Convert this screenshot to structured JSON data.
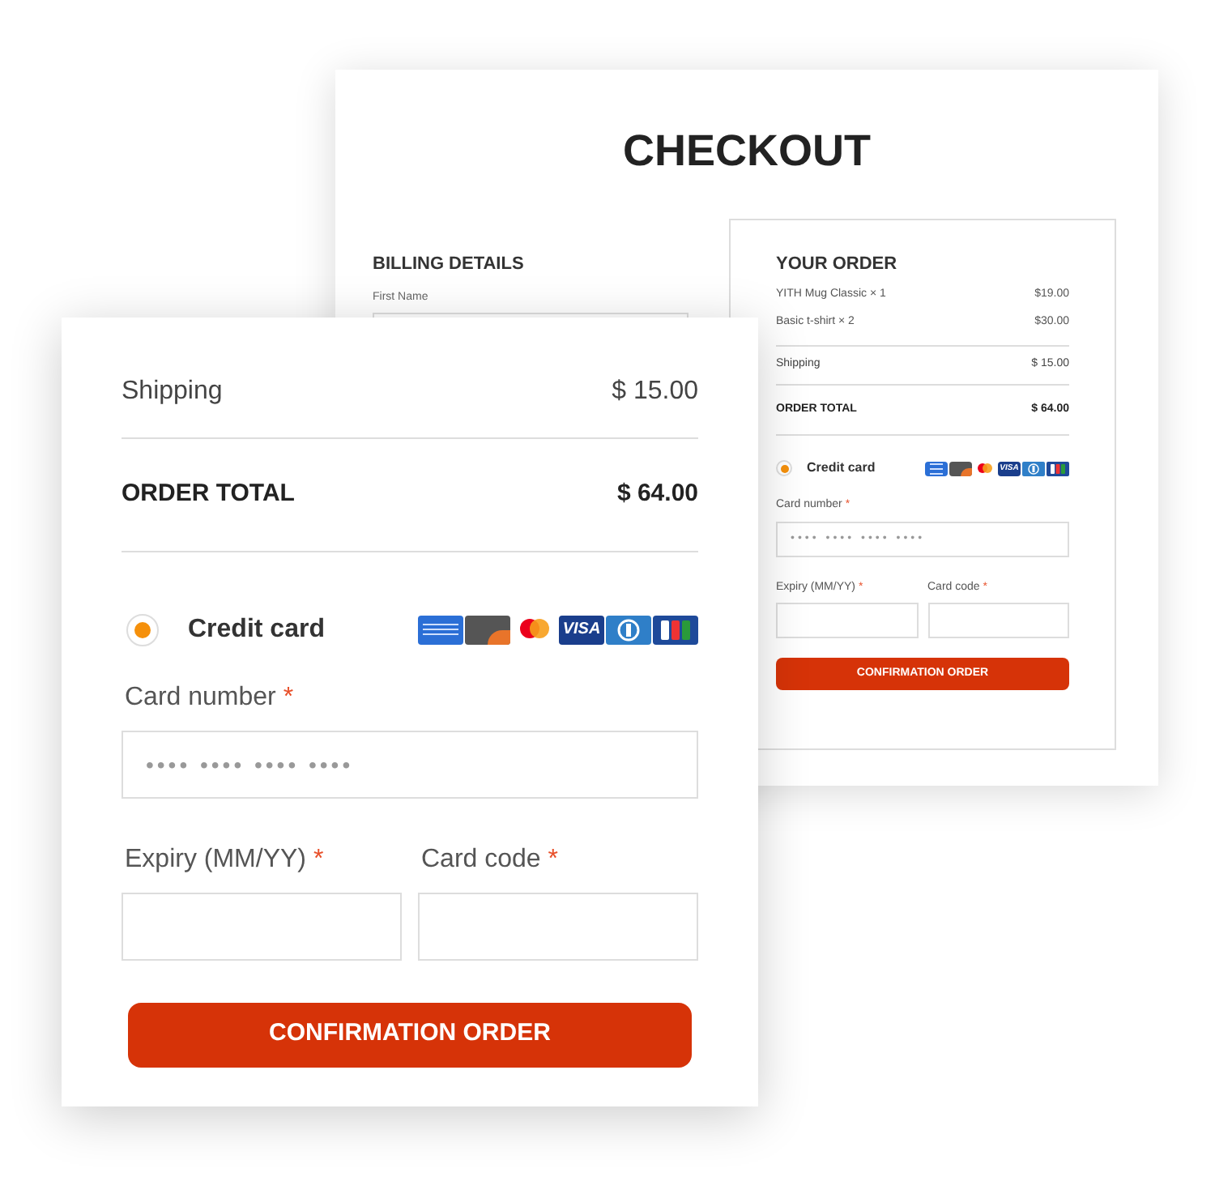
{
  "back_card": {
    "title": "CHECKOUT",
    "billing": {
      "heading": "BILLING DETAILS",
      "field_label": "First Name"
    },
    "order": {
      "heading": "YOUR ORDER",
      "items": [
        {
          "name": "YITH Mug Classic",
          "qty": "× 1",
          "price": "$19.00"
        },
        {
          "name": "Basic t-shirt",
          "qty": "× 2",
          "price": "$30.00"
        }
      ],
      "shipping": {
        "label": "Shipping",
        "value": "$ 15.00"
      },
      "total": {
        "label": "ORDER TOTAL",
        "value": "$ 64.00"
      },
      "payment": {
        "label": "Credit card",
        "selected": true,
        "logos": [
          {
            "kind": "amex"
          },
          {
            "kind": "discover"
          },
          {
            "kind": "mastercard"
          },
          {
            "kind": "visa",
            "text": "VISA"
          },
          {
            "kind": "diners"
          },
          {
            "kind": "jcb"
          }
        ]
      },
      "fields": [
        {
          "label": "Card number",
          "required": "*",
          "placeholder": "•••• •••• •••• ••••"
        },
        {
          "label": "Expiry (MM/YY)",
          "required": "*"
        },
        {
          "label": "Card code",
          "required": "*"
        }
      ],
      "button": "CONFIRMATION ORDER"
    }
  },
  "front_card": {
    "shipping": {
      "label": "Shipping",
      "value": "$ 15.00"
    },
    "total": {
      "label": "ORDER TOTAL",
      "value": "$ 64.00"
    },
    "payment": {
      "label": "Credit card",
      "selected": true,
      "logos": [
        {
          "kind": "amex"
        },
        {
          "kind": "discover"
        },
        {
          "kind": "mastercard"
        },
        {
          "kind": "visa",
          "text": "VISA"
        },
        {
          "kind": "diners"
        },
        {
          "kind": "jcb"
        }
      ]
    },
    "fields": [
      {
        "label": "Card number",
        "required": "*",
        "placeholder": "•••• •••• •••• ••••"
      },
      {
        "label": "Expiry (MM/YY)",
        "required": "*"
      },
      {
        "label": "Card code",
        "required": "*"
      }
    ],
    "button": "CONFIRMATION ORDER"
  }
}
